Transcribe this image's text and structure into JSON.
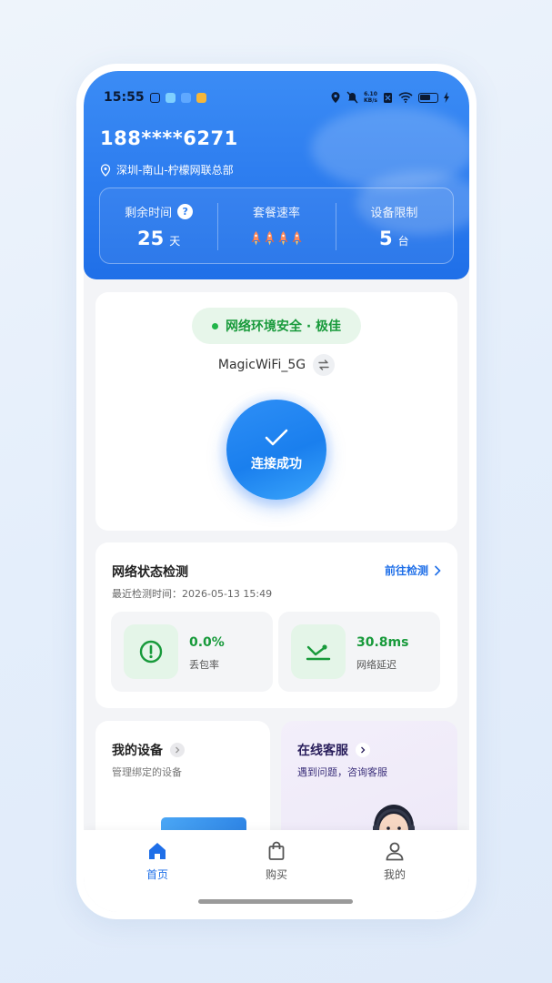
{
  "status_bar": {
    "time": "15:55",
    "net_speed_value": "6.10",
    "net_speed_unit": "KB/s"
  },
  "account": {
    "phone": "188****6271",
    "location": "深圳-南山-柠檬网联总部"
  },
  "stats": {
    "remaining_time_label": "剩余时间",
    "remaining_time_value": "25",
    "remaining_time_unit": "天",
    "plan_speed_label": "套餐速率",
    "plan_speed_level": 4,
    "device_limit_label": "设备限制",
    "device_limit_value": "5",
    "device_limit_unit": "台"
  },
  "connection": {
    "safety_status": "网络环境安全 · 极佳",
    "ssid": "MagicWiFi_5G",
    "status_label": "连接成功"
  },
  "network_check": {
    "title": "网络状态检测",
    "go_label": "前往检测",
    "last_check": "最近检测时间：2026-05-13 15:49",
    "packet_loss_value": "0.0%",
    "packet_loss_label": "丢包率",
    "latency_value": "30.8ms",
    "latency_label": "网络延迟"
  },
  "my_devices": {
    "title": "我的设备",
    "subtitle": "管理绑定的设备"
  },
  "support": {
    "title": "在线客服",
    "subtitle": "遇到问题，咨询客服"
  },
  "tabs": [
    {
      "label": "首页",
      "icon": "home-icon",
      "active": true
    },
    {
      "label": "购买",
      "icon": "shopping-bag-icon",
      "active": false
    },
    {
      "label": "我的",
      "icon": "user-icon",
      "active": false
    }
  ],
  "colors": {
    "brand_blue": "#1f6fe8",
    "success_green": "#189a3b",
    "safe_pill_bg": "#e7f6ea"
  }
}
